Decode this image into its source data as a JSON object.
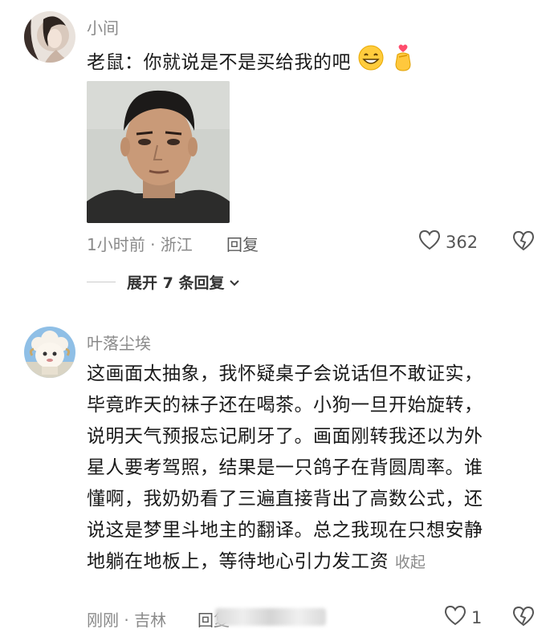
{
  "comment1": {
    "username": "小间",
    "text_prefix": "老鼠：你就说是不是买给我的吧",
    "emoji1": "grin-emoji",
    "emoji2": "finger-heart-emoji",
    "image_alt": "photo-of-man",
    "time_loc": "1小时前 · 浙江",
    "reply_label": "回复",
    "likes": "362",
    "expand_label": "展开 7 条回复"
  },
  "comment2": {
    "username": "叶落尘埃",
    "lines": [
      "这画面太抽象，我怀疑桌子会说话但不敢证实，",
      "毕竟昨天的袜子还在喝茶。小狗一旦开始旋转，",
      "说明天气预报忘记刷牙了。画面刚转我还以为外",
      "星人要考驾照，结果是一只鸽子在背圆周率。谁",
      "懂啊，我奶奶看了三遍直接背出了高数公式，还",
      "说这是梦里斗地主的翻译。总之我现在只想安静",
      "地躺在地板上，等待地心引力发工资"
    ],
    "collapse_label": "收起",
    "time_loc": "刚刚 · 吉林",
    "reply_label": "回复",
    "likes": "1"
  },
  "colors": {
    "meta_gray": "#8a8a8a",
    "text": "#1a1a1a"
  }
}
